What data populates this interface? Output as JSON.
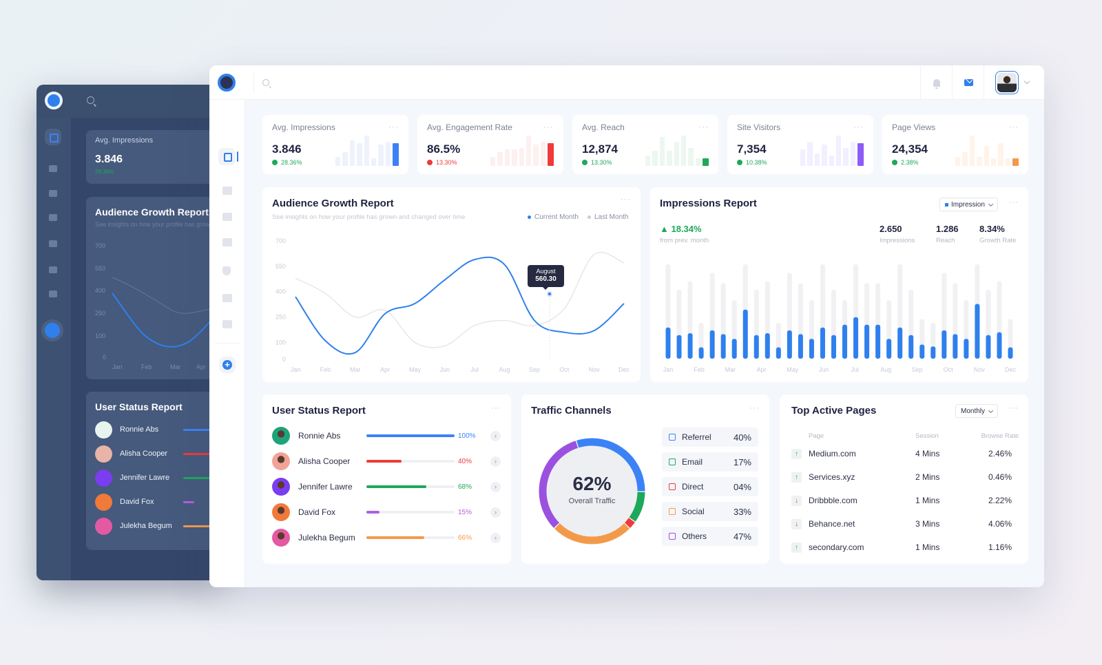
{
  "dark_preview": {
    "stat": {
      "label": "Avg. Impressions",
      "value": "3.846",
      "change": "28.36%"
    },
    "audience": {
      "title": "Audience Growth Report",
      "subtitle": "See insights on how your profile has grown and changed over time",
      "y_ticks": [
        "700",
        "550",
        "400",
        "250",
        "100",
        "0"
      ],
      "x_ticks": [
        "Jan",
        "Feb",
        "Mar",
        "Apr"
      ]
    },
    "user_status": {
      "title": "User Status Report",
      "users": [
        "Ronnie Abs",
        "Alisha Cooper",
        "Jennifer Lawre",
        "David Fox",
        "Julekha Begum"
      ]
    }
  },
  "topbar": {
    "search_placeholder": "",
    "icons": [
      "bell-icon",
      "mail-icon"
    ],
    "colors": {
      "accent": "#2f80ed"
    }
  },
  "sidebar": {
    "items": [
      {
        "icon": "dashboard-icon",
        "active": true
      },
      {
        "icon": "folder-icon",
        "active": false
      },
      {
        "icon": "folder-open-icon",
        "active": false
      },
      {
        "icon": "chart-icon",
        "active": false
      },
      {
        "icon": "shield-icon",
        "active": false
      },
      {
        "icon": "grid-icon",
        "active": false
      },
      {
        "icon": "list-icon",
        "active": false
      }
    ],
    "add_icon": "plus-circle-icon"
  },
  "stats": [
    {
      "label": "Avg. Impressions",
      "value": "3.846",
      "change": "28.36%",
      "trend": "up",
      "color": "#3b82f6",
      "tint": "#eef2fb",
      "bars": [
        0.3,
        0.45,
        0.85,
        0.75,
        1.0,
        0.25,
        0.7,
        0.8
      ]
    },
    {
      "label": "Avg. Engagement Rate",
      "value": "86.5%",
      "change": "13.30%",
      "trend": "down",
      "color": "#ef3a3a",
      "tint": "#fdf0f0",
      "bars": [
        0.3,
        0.45,
        0.55,
        0.55,
        0.6,
        1.0,
        0.7,
        0.8
      ]
    },
    {
      "label": "Avg. Reach",
      "value": "12,874",
      "change": "13.30%",
      "trend": "up",
      "color": "#1ea85a",
      "tint": "#ecf7f0",
      "bars": [
        0.35,
        0.5,
        0.95,
        0.5,
        0.8,
        1.0,
        0.6,
        0.25
      ]
    },
    {
      "label": "Site Visitors",
      "value": "7,354",
      "change": "10.38%",
      "trend": "up",
      "color": "#8b5cf6",
      "tint": "#f2efff",
      "bars": [
        0.55,
        0.8,
        0.4,
        0.7,
        0.35,
        1.0,
        0.6,
        0.8
      ]
    },
    {
      "label": "Page Views",
      "value": "24,354",
      "change": "2.38%",
      "trend": "up",
      "color": "#f39a4a",
      "tint": "#fff3ea",
      "bars": [
        0.3,
        0.45,
        1.0,
        0.3,
        0.65,
        0.25,
        0.75,
        0.25
      ]
    }
  ],
  "audience": {
    "title": "Audience Growth Report",
    "subtitle": "See insights on how your profile has grown and changed over time",
    "legend": [
      {
        "label": "Current Month",
        "color": "#2f80ed"
      },
      {
        "label": "Last Month",
        "color": "#c9ccd4"
      }
    ],
    "tooltip": {
      "label": "August",
      "value": "560.30"
    }
  },
  "impressions": {
    "title": "Impressions Report",
    "select": "Impression",
    "growth": "18.34%",
    "growth_caption": "from prev. month",
    "metrics": [
      {
        "value": "2.650",
        "label": "Impressions"
      },
      {
        "value": "1.286",
        "label": "Reach"
      },
      {
        "value": "8.34%",
        "label": "Growth Rate"
      }
    ]
  },
  "user_status": {
    "title": "User Status Report",
    "users": [
      {
        "name": "Ronnie Abs",
        "percent": 100,
        "label": "100%",
        "color": "#3b82f6",
        "avatar": "#1fa37a"
      },
      {
        "name": "Alisha Cooper",
        "percent": 40,
        "label": "40%",
        "color": "#ef3a3a",
        "avatar": "#f0a396"
      },
      {
        "name": "Jennifer Lawre",
        "percent": 68,
        "label": "68%",
        "color": "#1ea85a",
        "avatar": "#7a3df0"
      },
      {
        "name": "David Fox",
        "percent": 15,
        "label": "15%",
        "color": "#b45ddf",
        "avatar": "#f07a3a"
      },
      {
        "name": "Julekha Begum",
        "percent": 66,
        "label": "66%",
        "color": "#f39a4a",
        "avatar": "#e35aa2"
      }
    ]
  },
  "traffic": {
    "title": "Traffic Channels",
    "center_value": "62%",
    "center_label": "Overall Traffic",
    "channels": [
      {
        "name": "Referrel",
        "value": "40%",
        "color": "#3b82f6"
      },
      {
        "name": "Email",
        "value": "17%",
        "color": "#1ea85a"
      },
      {
        "name": "Direct",
        "value": "04%",
        "color": "#ef3a3a"
      },
      {
        "name": "Social",
        "value": "33%",
        "color": "#f39a4a"
      },
      {
        "name": "Others",
        "value": "47%",
        "color": "#9b51e0"
      }
    ]
  },
  "top_pages": {
    "title": "Top Active Pages",
    "select": "Monthly",
    "headers": [
      "Page",
      "Session",
      "Browse Rate"
    ],
    "rows": [
      {
        "trend": "up",
        "page": "Medium.com",
        "session": "4 Mins",
        "rate": "2.46%"
      },
      {
        "trend": "up",
        "page": "Services.xyz",
        "session": "2 Mins",
        "rate": "0.46%"
      },
      {
        "trend": "down",
        "page": "Dribbble.com",
        "session": "1 Mins",
        "rate": "2.22%"
      },
      {
        "trend": "down",
        "page": "Behance.net",
        "session": "3 Mins",
        "rate": "4.06%"
      },
      {
        "trend": "up",
        "page": "secondary.com",
        "session": "1 Mins",
        "rate": "1.16%"
      }
    ]
  },
  "chart_data": [
    {
      "type": "line",
      "title": "Audience Growth Report",
      "x": [
        "Jan",
        "Feb",
        "Mar",
        "Apr",
        "May",
        "Jun",
        "Jul",
        "Aug",
        "Sep",
        "Oct",
        "Nov",
        "Dec"
      ],
      "series": [
        {
          "name": "Current Month",
          "values": [
            370,
            110,
            40,
            270,
            330,
            470,
            590,
            560,
            230,
            160,
            170,
            330
          ]
        },
        {
          "name": "Last Month",
          "values": [
            480,
            390,
            250,
            290,
            100,
            80,
            200,
            230,
            200,
            300,
            620,
            570
          ]
        }
      ],
      "ylim": [
        0,
        700
      ],
      "y_ticks": [
        0,
        100,
        250,
        400,
        550,
        700
      ],
      "annotation": {
        "x": "Sep",
        "label": "August",
        "value": 560.3
      }
    },
    {
      "type": "bar",
      "title": "Impressions Report",
      "x_ticks": [
        "Jan",
        "Feb",
        "Mar",
        "Apr",
        "May",
        "Jun",
        "Jul",
        "Aug",
        "Sep",
        "Oct",
        "Nov",
        "Dec"
      ],
      "series": [
        {
          "name": "Impression",
          "values": [
            33,
            25,
            27,
            12,
            30,
            26,
            21,
            52,
            25,
            27,
            12,
            30,
            26,
            21,
            33,
            25,
            36,
            44,
            36,
            36,
            21,
            33,
            25,
            15,
            13,
            30,
            26,
            21,
            58,
            25,
            28,
            12
          ]
        },
        {
          "name": "Total",
          "values": [
            100,
            73,
            82,
            38,
            91,
            80,
            62,
            100,
            73,
            82,
            38,
            91,
            80,
            62,
            100,
            73,
            62,
            100,
            80,
            80,
            62,
            100,
            73,
            42,
            38,
            91,
            80,
            62,
            100,
            73,
            82,
            42
          ]
        }
      ],
      "ymax": 100
    },
    {
      "type": "pie",
      "title": "Traffic Channels",
      "categories": [
        "Referrel",
        "Email",
        "Direct",
        "Social",
        "Others"
      ],
      "values": [
        40,
        17,
        4,
        33,
        47
      ],
      "center": "62% Overall Traffic"
    }
  ]
}
